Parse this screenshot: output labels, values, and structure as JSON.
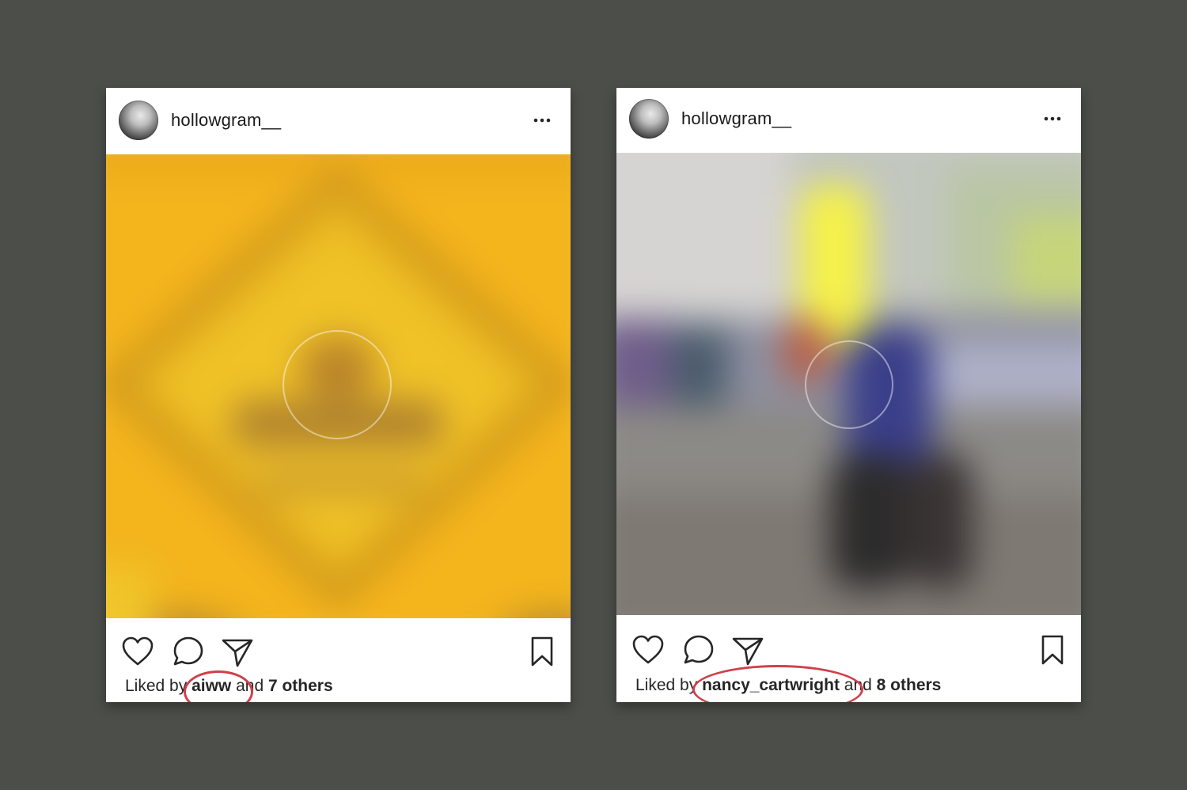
{
  "posts": [
    {
      "username": "hollowgram__",
      "likes_prefix": "Liked by ",
      "liker": "aiww",
      "likes_middle": " and ",
      "likes_count": "7 others",
      "annotation_color": "#d0404b"
    },
    {
      "username": "hollowgram__",
      "likes_prefix": "Liked by ",
      "liker": "nancy_cartwright",
      "likes_middle": " and ",
      "likes_count": "8 others",
      "annotation_color": "#d0404b"
    }
  ],
  "icons": {
    "more": "more-options-icon",
    "like": "heart-icon",
    "comment": "comment-bubble-icon",
    "share": "paper-plane-icon",
    "save": "bookmark-icon",
    "media": "play-circle-icon"
  },
  "colors": {
    "background": "#4c4e49",
    "card": "#ffffff",
    "annotation": "#d0404b"
  }
}
